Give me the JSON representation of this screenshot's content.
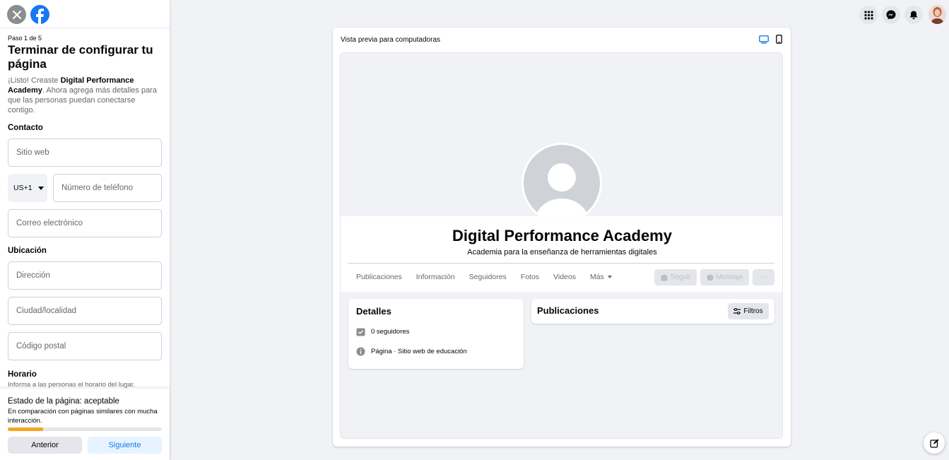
{
  "sidebar": {
    "step": "Paso 1 de 5",
    "title": "Terminar de configurar tu página",
    "desc_prefix": "¡Listo! Creaste ",
    "desc_page": "Digital Performance Academy",
    "desc_suffix": ". Ahora agrega más detalles para que las personas puedan conectarse contigo.",
    "contact_heading": "Contacto",
    "website_placeholder": "Sitio web",
    "country_code": "US+1",
    "phone_placeholder": "Número de teléfono",
    "email_placeholder": "Correo electrónico",
    "location_heading": "Ubicación",
    "address_placeholder": "Dirección",
    "city_placeholder": "Ciudad/localidad",
    "zip_placeholder": "Código postal",
    "hours_heading": "Horario",
    "hours_hint": "Informa a las personas el horario del lugar."
  },
  "footer": {
    "status_title": "Estado de la página: aceptable",
    "status_desc": "En comparación con páginas similares con mucha interacción.",
    "progress_percent": 23,
    "progress_color": "#f5a623",
    "prev_label": "Anterior",
    "next_label": "Siguiente"
  },
  "preview": {
    "label": "Vista previa para computadoras",
    "page_name": "Digital Performance Academy",
    "page_category": "Academia para la enseñanza de herramientas digitales",
    "tabs": [
      "Publicaciones",
      "Información",
      "Seguidores",
      "Fotos",
      "Videos",
      "Más"
    ],
    "follow_label": "Seguir",
    "message_label": "Mensaje",
    "more_label": "···",
    "details_title": "Detalles",
    "followers": "0 seguidores",
    "page_type_prefix": "Página",
    "page_type": " · Sitio web de educación",
    "posts_title": "Publicaciones",
    "filters_label": "Filtros"
  },
  "colors": {
    "brand": "#1877f2",
    "background": "#f0f2f5"
  }
}
